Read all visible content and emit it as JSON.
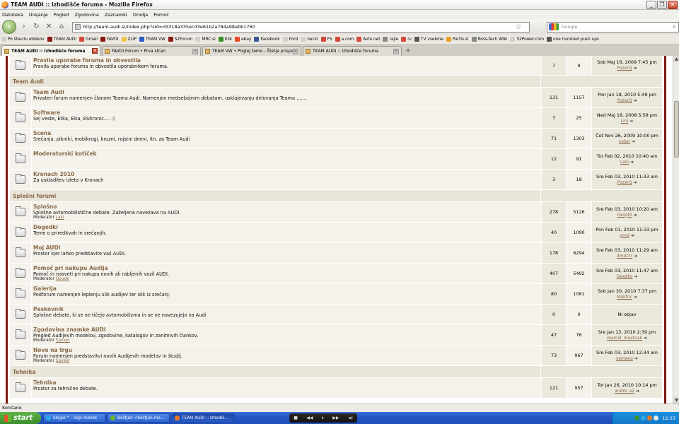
{
  "window": {
    "title": "TEAM AUDI :: Izhodišče foruma - Mozilla Firefox",
    "buttons": [
      "_",
      "❐",
      "✕"
    ]
  },
  "menu": [
    "Datoteka",
    "Urejanje",
    "Pogled",
    "Zgodovina",
    "Zaznamki",
    "Orodja",
    "Pomoč"
  ],
  "nav": {
    "url": "http://team-audi.si/index.php?sid=d3318a335ecd3e61b2a784a98abb1760",
    "search_placeholder": "Google",
    "icons": [
      "back-icon",
      "forward-icon",
      "reload-icon",
      "stop-icon",
      "home-icon",
      "star-icon",
      "search-icon"
    ]
  },
  "bookmarks": [
    {
      "label": "Po številu obiskov",
      "color": "#d0d0d0"
    },
    {
      "label": "TEAM AUDI",
      "color": "#8a1a12"
    },
    {
      "label": "Gmail",
      "color": "#d44a3a"
    },
    {
      "label": "FAVDI",
      "color": "#8a1a12"
    },
    {
      "label": "ZLIP",
      "color": "#f2c54a"
    },
    {
      "label": "TEAM VW",
      "color": "#2a5cc5"
    },
    {
      "label": "S2Forum",
      "color": "#8a1a12"
    },
    {
      "label": "MRC.si",
      "color": "#d0d0d0"
    },
    {
      "label": "Klik",
      "color": "#3a8f2a"
    },
    {
      "label": "ebay",
      "color": "#e84a2a"
    },
    {
      "label": "Facebook",
      "color": "#3b5998"
    },
    {
      "label": "Ford",
      "color": "#d0d0d0"
    },
    {
      "label": "necki",
      "color": "#d0d0d0"
    },
    {
      "label": "FS",
      "color": "#d44a3a"
    },
    {
      "label": "a.com",
      "color": "#d44a3a"
    },
    {
      "label": "Avto.net",
      "color": "#d44a3a"
    },
    {
      "label": "rajle",
      "color": "#888888"
    },
    {
      "label": "rv",
      "color": "#d44a3a"
    },
    {
      "label": "TV vsebine",
      "color": "#555555"
    },
    {
      "label": "Partis.si",
      "color": "#e8a02a"
    },
    {
      "label": "Ross-Tech Wiki",
      "color": "#888888"
    },
    {
      "label": "S2Power.com",
      "color": "#d0d0d0"
    },
    {
      "label": "one hundred push ups",
      "color": "#555555"
    }
  ],
  "tabs": [
    {
      "label": "TEAM AUDI :: Izhodišče foruma",
      "active": true
    },
    {
      "label": "FAVDI Forum • Prva stran",
      "active": false
    },
    {
      "label": "TEAM VW • Poglej temo - Štetje prispe...",
      "active": false
    },
    {
      "label": "TEAM AUDI :: Izhodišče foruma",
      "active": false
    }
  ],
  "forum": {
    "moderator_label": "Moderator",
    "rows": [
      {
        "kind": "forum",
        "name": "Pravila uporabe foruma in obvestila",
        "desc": "Pravila uporabe foruma in obvestila uporabnikom foruma.",
        "topics": "7",
        "posts": "9",
        "last_date": "Sob Maj 16, 2009 7:45 pm",
        "last_user": "PozerQ"
      },
      {
        "kind": "category",
        "name": "Team Audi"
      },
      {
        "kind": "forum",
        "name": "Team Audi",
        "desc": "Privaten forum namenjen članom Teama Audi. Namenjen medsebojnim debatam, usklajevanju delovanja Teama .......",
        "topics": "131",
        "posts": "1157",
        "last_date": "Pon Jan 18, 2010 5:49 pm",
        "last_user": "PozerQ"
      },
      {
        "kind": "forum",
        "name": "Software",
        "desc": "Sej veste, Etka, Elsa, ESItronic.... :)",
        "topics": "7",
        "posts": "25",
        "last_date": "Ned Maj 18, 2008 5:58 pm",
        "last_user": "Lini"
      },
      {
        "kind": "forum",
        "name": "Scena",
        "desc": "Srečanja, pikniki, mobikrogi, kruzni, rojstni dnevi, itn. za Team Audi",
        "topics": "71",
        "posts": "1303",
        "last_date": "Čet Nov 26, 2009 10:00 pm",
        "last_user": "cešar"
      },
      {
        "kind": "forum",
        "name": "Moderatorski kotiček",
        "desc": "",
        "topics": "12",
        "posts": "91",
        "last_date": "Tor Feb 02, 2010 10:40 am",
        "last_user": "Laki"
      },
      {
        "kind": "forum",
        "name": "Kronach 2010",
        "desc": "Za uskladitev izleta v Kronach",
        "topics": "3",
        "posts": "18",
        "last_date": "Sre Feb 03, 2010 11:33 am",
        "last_user": "PozerQ"
      },
      {
        "kind": "category",
        "name": "Splošni forumi"
      },
      {
        "kind": "forum",
        "name": "Splošno",
        "desc": "Splošne avtomobilistične debate. Zaželjena navezava na AUDI.",
        "moderator": "Laki",
        "topics": "278",
        "posts": "5126",
        "last_date": "Sre Feb 03, 2010 10:20 am",
        "last_user": "Dwight"
      },
      {
        "kind": "forum",
        "name": "Dogodki",
        "desc": "Teme o prireditvah in srečanjih.",
        "topics": "40",
        "posts": "1090",
        "last_date": "Pon Feb 01, 2010 11:33 pm",
        "last_user": "pmd"
      },
      {
        "kind": "forum",
        "name": "Moj AUDI",
        "desc": "Prostor kjer lahko predstavite vaš AUDI.",
        "topics": "178",
        "posts": "6294",
        "last_date": "Sre Feb 03, 2010 11:29 am",
        "last_user": "4m4t3r"
      },
      {
        "kind": "forum",
        "name": "Pomoč pri nakupu Audija",
        "desc": "Pomoč in nasveti pri nakupu novih ali rabljenih vozil AUDI.",
        "moderator": "Goude",
        "topics": "407",
        "posts": "5492",
        "last_date": "Sre Feb 03, 2010 11:47 am",
        "last_user": "Deedko"
      },
      {
        "kind": "forum",
        "name": "Galerija",
        "desc": "Podforum namenjen leplenju slik audijev ter slik iz srečanj.",
        "topics": "80",
        "posts": "1081",
        "last_date": "Sob Jan 30, 2010 7:37 pm",
        "last_user": "Malifric"
      },
      {
        "kind": "forum",
        "name": "Peskovnik",
        "desc": "Splošne debate, ki se ne tičejo avtomobilizma in se ne navezujejo na Audi",
        "topics": "0",
        "posts": "0",
        "last_date": "Ni objav",
        "last_user": ""
      },
      {
        "kind": "forum",
        "name": "Zgodovina znamke AUDI",
        "desc": "Pregled Audijevih modelov, zgodovine, katalogov in zanimivih člankov.",
        "moderator": "Spyker",
        "topics": "47",
        "posts": "76",
        "last_date": "Sre Jan 13, 2010 2:39 pm",
        "last_user": "marcel_maxtnak"
      },
      {
        "kind": "forum",
        "name": "Novo na trgu",
        "desc": "Forum namenjen predstavitvi novih Audijevih modelov in študij.",
        "moderator": "Spyker",
        "topics": "73",
        "posts": "967",
        "last_date": "Sre Feb 03, 2010 12:34 am",
        "last_user": "semeno"
      },
      {
        "kind": "category",
        "name": "Tehnika"
      },
      {
        "kind": "forum",
        "name": "Tehnika",
        "desc": "Prostor za tehnične debate.",
        "topics": "121",
        "posts": "957",
        "last_date": "Tor Jan 26, 2010 10:14 pm",
        "last_user": "andre_a2"
      }
    ]
  },
  "status": "Končano",
  "taskbar": {
    "start": "start",
    "tasks": [
      {
        "label": "Skype™ - nejc.mozek",
        "active": false
      },
      {
        "label": "Boštjan <bostjan.mo...",
        "active": false
      },
      {
        "label": "TEAM AUDI :: Izhodiš...",
        "active": true
      }
    ],
    "clock": "12:23"
  }
}
